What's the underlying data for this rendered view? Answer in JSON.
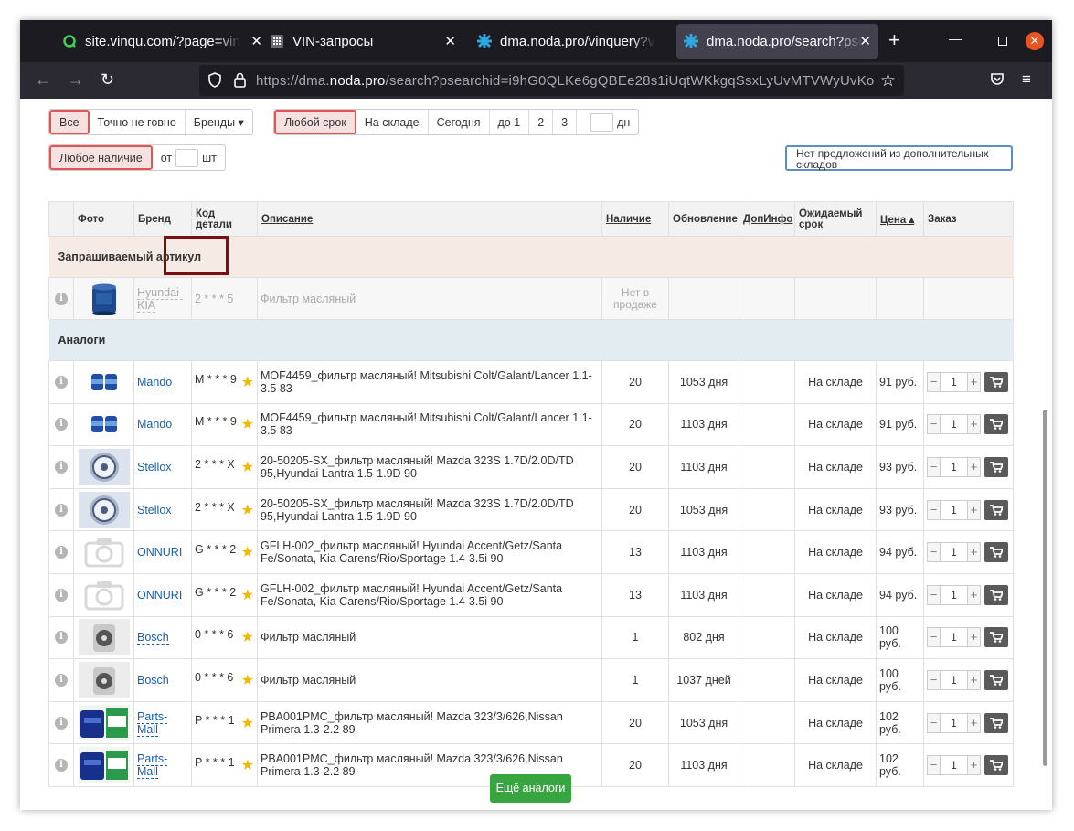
{
  "browser": {
    "tabs": [
      {
        "title": "site.vinqu.com/?page=vin",
        "icon": "vinqu-icon"
      },
      {
        "title": "VIN-запросы",
        "icon": "grid-icon"
      },
      {
        "title": "dma.noda.pro/vinquery?v",
        "icon": "noda-icon"
      },
      {
        "title": "dma.noda.pro/search?pse",
        "icon": "noda-icon"
      }
    ],
    "url_prefix": "https://dma.",
    "url_host": "noda.pro",
    "url_rest": "/search?psearchid=i9hG0QLKe6gQBEe28s1iUqtWKkgqSsxLyUvMTVWyUvKo"
  },
  "filters": {
    "group1": [
      "Все",
      "Точно не говно",
      "Бренды ▾"
    ],
    "group2": [
      "Любой срок",
      "На складе",
      "Сегодня",
      "до 1",
      "2",
      "3"
    ],
    "days_unit": "дн",
    "stock_any": "Любое наличие",
    "stock_from": "от",
    "stock_unit": "шт",
    "note": "Нет предложений из дополнительных складов"
  },
  "table": {
    "headers": [
      "",
      "Фото",
      "Бренд",
      "Код детали",
      "Описание",
      "Наличие",
      "Обновление",
      "ДопИнфо",
      "Ожидаемый срок",
      "Цена ▴",
      "Заказ"
    ],
    "section_requested": "Запрашиваемый артикул",
    "requested": {
      "brand": "Hyundai-KIA",
      "code": "2 * * * 5",
      "desc": "Фильтр масляный",
      "stock": "Нет в продаже"
    },
    "section_analogs": "Аналоги",
    "rows": [
      {
        "brand": "Mando",
        "code": "M * * * 9",
        "desc": "MOF4459_фильтр масляный! Mitsubishi Colt/Galant/Lancer 1.1-3.5 83",
        "stock": "20",
        "updated": "1053 дня",
        "eta": "На складе",
        "price": "91 руб.",
        "qty": "1",
        "photo": "mando"
      },
      {
        "brand": "Mando",
        "code": "M * * * 9",
        "desc": "MOF4459_фильтр масляный! Mitsubishi Colt/Galant/Lancer 1.1-3.5 83",
        "stock": "20",
        "updated": "1103 дня",
        "eta": "На складе",
        "price": "91 руб.",
        "qty": "1",
        "photo": "mando"
      },
      {
        "brand": "Stellox",
        "code": "2 * * * X",
        "desc": "20-50205-SX_фильтр масляный! Mazda 323S 1.7D/2.0D/TD 95,Hyundai Lantra 1.5-1.9D 90",
        "stock": "20",
        "updated": "1103 дня",
        "eta": "На складе",
        "price": "93 руб.",
        "qty": "1",
        "photo": "stellox"
      },
      {
        "brand": "Stellox",
        "code": "2 * * * X",
        "desc": "20-50205-SX_фильтр масляный! Mazda 323S 1.7D/2.0D/TD 95,Hyundai Lantra 1.5-1.9D 90",
        "stock": "20",
        "updated": "1053 дня",
        "eta": "На складе",
        "price": "93 руб.",
        "qty": "1",
        "photo": "stellox"
      },
      {
        "brand": "ONNURI",
        "code": "G * * * 2",
        "desc": "GFLH-002_фильтр масляный! Hyundai Accent/Getz/Santa Fe/Sonata, Kia Carens/Rio/Sportage 1.4-3.5i 90",
        "stock": "13",
        "updated": "1103 дня",
        "eta": "На складе",
        "price": "94 руб.",
        "qty": "1",
        "photo": "none"
      },
      {
        "brand": "ONNURI",
        "code": "G * * * 2",
        "desc": "GFLH-002_фильтр масляный! Hyundai Accent/Getz/Santa Fe/Sonata, Kia Carens/Rio/Sportage 1.4-3.5i 90",
        "stock": "13",
        "updated": "1103 дня",
        "eta": "На складе",
        "price": "94 руб.",
        "qty": "1",
        "photo": "none"
      },
      {
        "brand": "Bosch",
        "code": "0 * * * 6",
        "desc": "Фильтр масляный",
        "stock": "1",
        "updated": "802 дня",
        "eta": "На складе",
        "price": "100 руб.",
        "qty": "1",
        "photo": "bosch"
      },
      {
        "brand": "Bosch",
        "code": "0 * * * 6",
        "desc": "Фильтр масляный",
        "stock": "1",
        "updated": "1037 дней",
        "eta": "На складе",
        "price": "100 руб.",
        "qty": "1",
        "photo": "bosch"
      },
      {
        "brand": "Parts-Mall",
        "code": "P * * * 1",
        "desc": "PBA001PMC_фильтр масляный! Mazda 323/3/626,Nissan Primera 1.3-2.2 89",
        "stock": "20",
        "updated": "1053 дня",
        "eta": "На складе",
        "price": "102 руб.",
        "qty": "1",
        "photo": "partsmall"
      },
      {
        "brand": "Parts-Mall",
        "code": "P * * * 1",
        "desc": "PBA001PMC_фильтр масляный! Mazda 323/3/626,Nissan Primera 1.3-2.2 89",
        "stock": "20",
        "updated": "1103 дня",
        "eta": "На складе",
        "price": "102 руб.",
        "qty": "1",
        "photo": "partsmall"
      }
    ]
  },
  "more_button": "Ещё аналоги"
}
